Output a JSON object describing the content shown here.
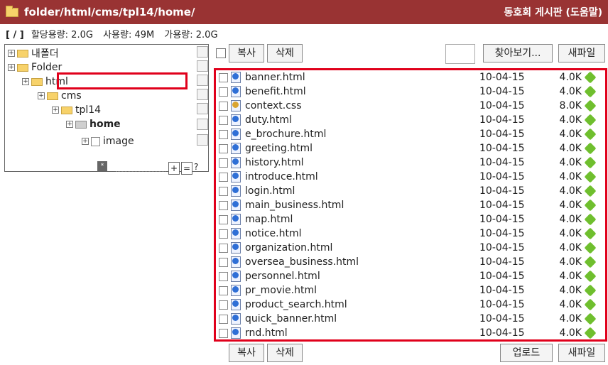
{
  "title_bar": {
    "path": "folder/html/cms/tpl14/home/",
    "board": "동호회 게시판 (도움말)"
  },
  "quota": {
    "root": "[ / ]",
    "allocated": "할당용량: 2.0G",
    "used": "사용량: 49M",
    "available": "가용량: 2.0G"
  },
  "tree": {
    "items": [
      {
        "label": "내폴더"
      },
      {
        "label": "Folder"
      },
      {
        "label": "html"
      },
      {
        "label": "cms"
      },
      {
        "label": "tpl14"
      },
      {
        "label": "home"
      },
      {
        "label": "image"
      }
    ],
    "plus_label": "+",
    "equal_label": "=",
    "question_label": "?"
  },
  "toolbar_top": {
    "copy": "복사",
    "delete": "삭제",
    "browse": "찾아보기...",
    "new_file": "새파일"
  },
  "toolbar_bottom": {
    "copy": "복사",
    "delete": "삭제",
    "upload": "업로드",
    "new_file": "새파일"
  },
  "files": [
    {
      "name": "banner.html",
      "date": "10-04-15",
      "size": "4.0K",
      "icon": "html-file-icon"
    },
    {
      "name": "benefit.html",
      "date": "10-04-15",
      "size": "4.0K",
      "icon": "html-file-icon"
    },
    {
      "name": "context.css",
      "date": "10-04-15",
      "size": "8.0K",
      "icon": "css-file-icon"
    },
    {
      "name": "duty.html",
      "date": "10-04-15",
      "size": "4.0K",
      "icon": "html-file-icon"
    },
    {
      "name": "e_brochure.html",
      "date": "10-04-15",
      "size": "4.0K",
      "icon": "html-file-icon"
    },
    {
      "name": "greeting.html",
      "date": "10-04-15",
      "size": "4.0K",
      "icon": "html-file-icon"
    },
    {
      "name": "history.html",
      "date": "10-04-15",
      "size": "4.0K",
      "icon": "html-file-icon"
    },
    {
      "name": "introduce.html",
      "date": "10-04-15",
      "size": "4.0K",
      "icon": "html-file-icon"
    },
    {
      "name": "login.html",
      "date": "10-04-15",
      "size": "4.0K",
      "icon": "html-file-icon"
    },
    {
      "name": "main_business.html",
      "date": "10-04-15",
      "size": "4.0K",
      "icon": "html-file-icon"
    },
    {
      "name": "map.html",
      "date": "10-04-15",
      "size": "4.0K",
      "icon": "html-file-icon"
    },
    {
      "name": "notice.html",
      "date": "10-04-15",
      "size": "4.0K",
      "icon": "html-file-icon"
    },
    {
      "name": "organization.html",
      "date": "10-04-15",
      "size": "4.0K",
      "icon": "html-file-icon"
    },
    {
      "name": "oversea_business.html",
      "date": "10-04-15",
      "size": "4.0K",
      "icon": "html-file-icon"
    },
    {
      "name": "personnel.html",
      "date": "10-04-15",
      "size": "4.0K",
      "icon": "html-file-icon"
    },
    {
      "name": "pr_movie.html",
      "date": "10-04-15",
      "size": "4.0K",
      "icon": "html-file-icon"
    },
    {
      "name": "product_search.html",
      "date": "10-04-15",
      "size": "4.0K",
      "icon": "html-file-icon"
    },
    {
      "name": "quick_banner.html",
      "date": "10-04-15",
      "size": "4.0K",
      "icon": "html-file-icon"
    },
    {
      "name": "rnd.html",
      "date": "10-04-15",
      "size": "4.0K",
      "icon": "html-file-icon"
    }
  ],
  "colors": {
    "title_bar": "#993333",
    "highlight": "#e0001b"
  }
}
